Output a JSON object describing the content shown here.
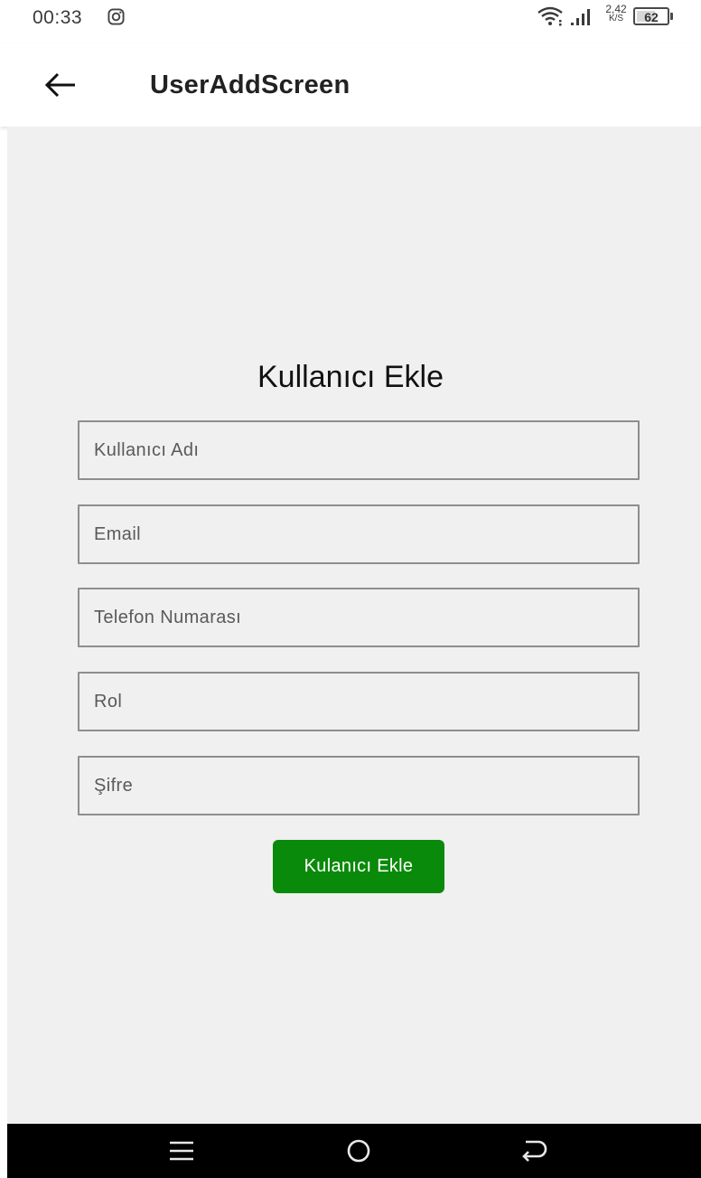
{
  "status_bar": {
    "time": "00:33",
    "speed_value": "2,42",
    "speed_unit": "K/S",
    "battery_level": "62",
    "battery_fraction": 0.62,
    "icons": [
      "instagram-icon",
      "wifi-icon",
      "signal-icon",
      "battery-icon"
    ]
  },
  "app_bar": {
    "title": "UserAddScreen",
    "back_icon": "arrow-left-icon"
  },
  "form": {
    "title": "Kullanıcı Ekle",
    "fields": [
      {
        "name": "username",
        "placeholder": "Kullanıcı Adı",
        "value": ""
      },
      {
        "name": "email",
        "placeholder": "Email",
        "value": ""
      },
      {
        "name": "phone",
        "placeholder": "Telefon Numarası",
        "value": ""
      },
      {
        "name": "role",
        "placeholder": "Rol",
        "value": ""
      },
      {
        "name": "password",
        "placeholder": "Şifre",
        "value": ""
      }
    ],
    "submit_label": "Kulanıcı Ekle"
  },
  "nav_bar": {
    "icons": [
      "menu-icon",
      "home-icon",
      "back-icon"
    ]
  },
  "colors": {
    "accent": "#0a8a0a",
    "background": "#f0f0f0",
    "app_bar": "#ffffff",
    "nav_bar": "#000000"
  }
}
